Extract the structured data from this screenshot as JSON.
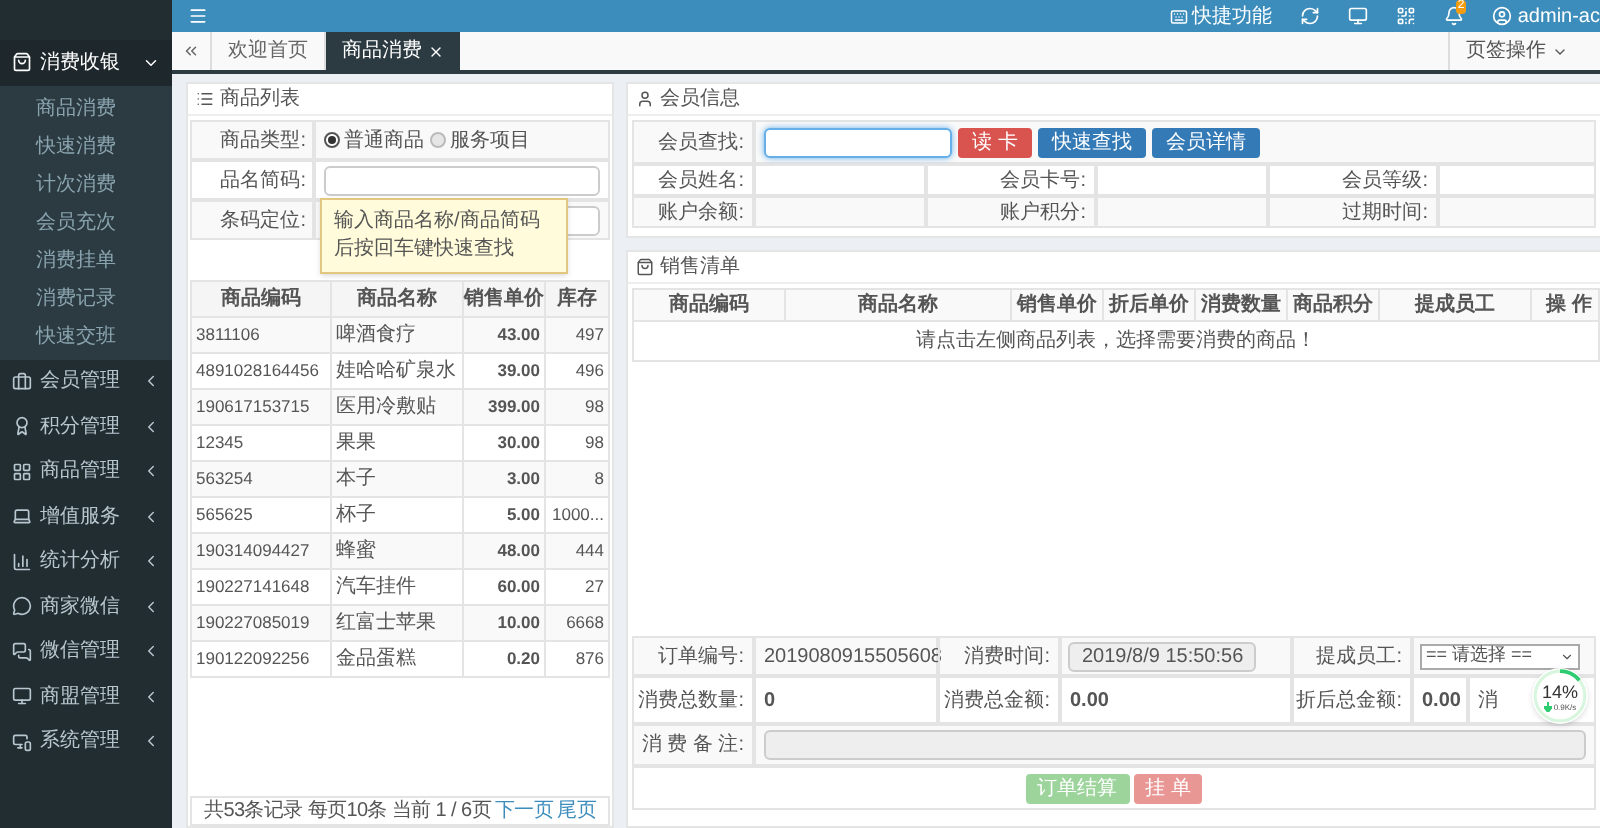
{
  "sidebar": {
    "menus": [
      {
        "label": "消费收银",
        "expanded": true,
        "children": [
          {
            "label": "商品消费"
          },
          {
            "label": "快速消费"
          },
          {
            "label": "计次消费"
          },
          {
            "label": "会员充次"
          },
          {
            "label": "消费挂单"
          },
          {
            "label": "消费记录"
          },
          {
            "label": "快速交班"
          }
        ]
      },
      {
        "label": "会员管理",
        "expanded": false
      },
      {
        "label": "积分管理",
        "expanded": false
      },
      {
        "label": "商品管理",
        "expanded": false
      },
      {
        "label": "增值服务",
        "expanded": false
      },
      {
        "label": "统计分析",
        "expanded": false
      },
      {
        "label": "商家微信",
        "expanded": false
      },
      {
        "label": "微信管理",
        "expanded": false
      },
      {
        "label": "商盟管理",
        "expanded": false
      },
      {
        "label": "系统管理",
        "expanded": false
      }
    ]
  },
  "topbar": {
    "shortcut": "快捷功能",
    "notification_count": "2",
    "user": "admin-ac"
  },
  "tabs": [
    {
      "label": "欢迎首页",
      "selected": false,
      "closable": false
    },
    {
      "label": "商品消费",
      "selected": true,
      "closable": true
    }
  ],
  "tab_actions": "页签操作",
  "product_list": {
    "title": "商品列表",
    "type_label": "商品类型:",
    "type_options": [
      {
        "label": "普通商品",
        "selected": true
      },
      {
        "label": "服务项目",
        "selected": false
      }
    ],
    "name_label": "品名简码:",
    "barcode_label": "条码定位:",
    "tooltip": "输入商品名称/商品简码后按回车键快速查找",
    "columns": [
      "商品编码",
      "商品名称",
      "销售单价",
      "库存"
    ],
    "rows": [
      [
        "3811106",
        "啤酒食疗",
        "43.00",
        "497"
      ],
      [
        "4891028164456",
        "娃哈哈矿泉水",
        "39.00",
        "496"
      ],
      [
        "190617153715",
        "医用冷敷贴",
        "399.00",
        "98"
      ],
      [
        "12345",
        "果果",
        "30.00",
        "98"
      ],
      [
        "563254",
        "本子",
        "3.00",
        "8"
      ],
      [
        "565625",
        "杯子",
        "5.00",
        "1000..."
      ],
      [
        "190314094427",
        "蜂蜜",
        "48.00",
        "444"
      ],
      [
        "190227141648",
        "汽车挂件",
        "60.00",
        "27"
      ],
      [
        "190227085019",
        "红富士苹果",
        "10.00",
        "6668"
      ],
      [
        "190122092256",
        "金品蛋糕",
        "0.20",
        "876"
      ]
    ],
    "pagination": "共53条记录 每页10条 当前 1 / 6页",
    "next": "下一页",
    "last": "尾页"
  },
  "member_info": {
    "title": "会员信息",
    "search_label": "会员查找:",
    "buttons": [
      {
        "label": "读 卡",
        "kind": "danger"
      },
      {
        "label": "快速查找",
        "kind": "primary"
      },
      {
        "label": "会员详情",
        "kind": "primary"
      }
    ],
    "fields": [
      [
        "会员姓名:",
        "会员卡号:",
        "会员等级:"
      ],
      [
        "账户余额:",
        "账户积分:",
        "过期时间:"
      ]
    ]
  },
  "sales_list": {
    "title": "销售清单",
    "columns": [
      "商品编码",
      "商品名称",
      "销售单价",
      "折后单价",
      "消费数量",
      "商品积分",
      "提成员工",
      "操 作"
    ],
    "empty": "请点击左侧商品列表，选择需要消费的商品！"
  },
  "order": {
    "number_label": "订单编号:",
    "number": "2019080915505608",
    "time_label": "消费时间:",
    "time": "2019/8/9 15:50:56",
    "staff_label": "提成员工:",
    "staff": "== 请选择 ==",
    "qty_label": "消费总数量:",
    "qty": "0",
    "amount_label": "消费总金额:",
    "amount": "0.00",
    "discount_label": "折后总金额:",
    "discount": "0.00",
    "cut_label": "消",
    "note_label": "消 费 备 注:",
    "buttons": [
      {
        "label": "订单结算",
        "kind": "success",
        "disabled": true
      },
      {
        "label": "挂 单",
        "kind": "danger",
        "disabled": true
      }
    ]
  },
  "speed_widget": {
    "percent": "14%",
    "speed": "0.9K/s",
    "level": 0.14
  }
}
